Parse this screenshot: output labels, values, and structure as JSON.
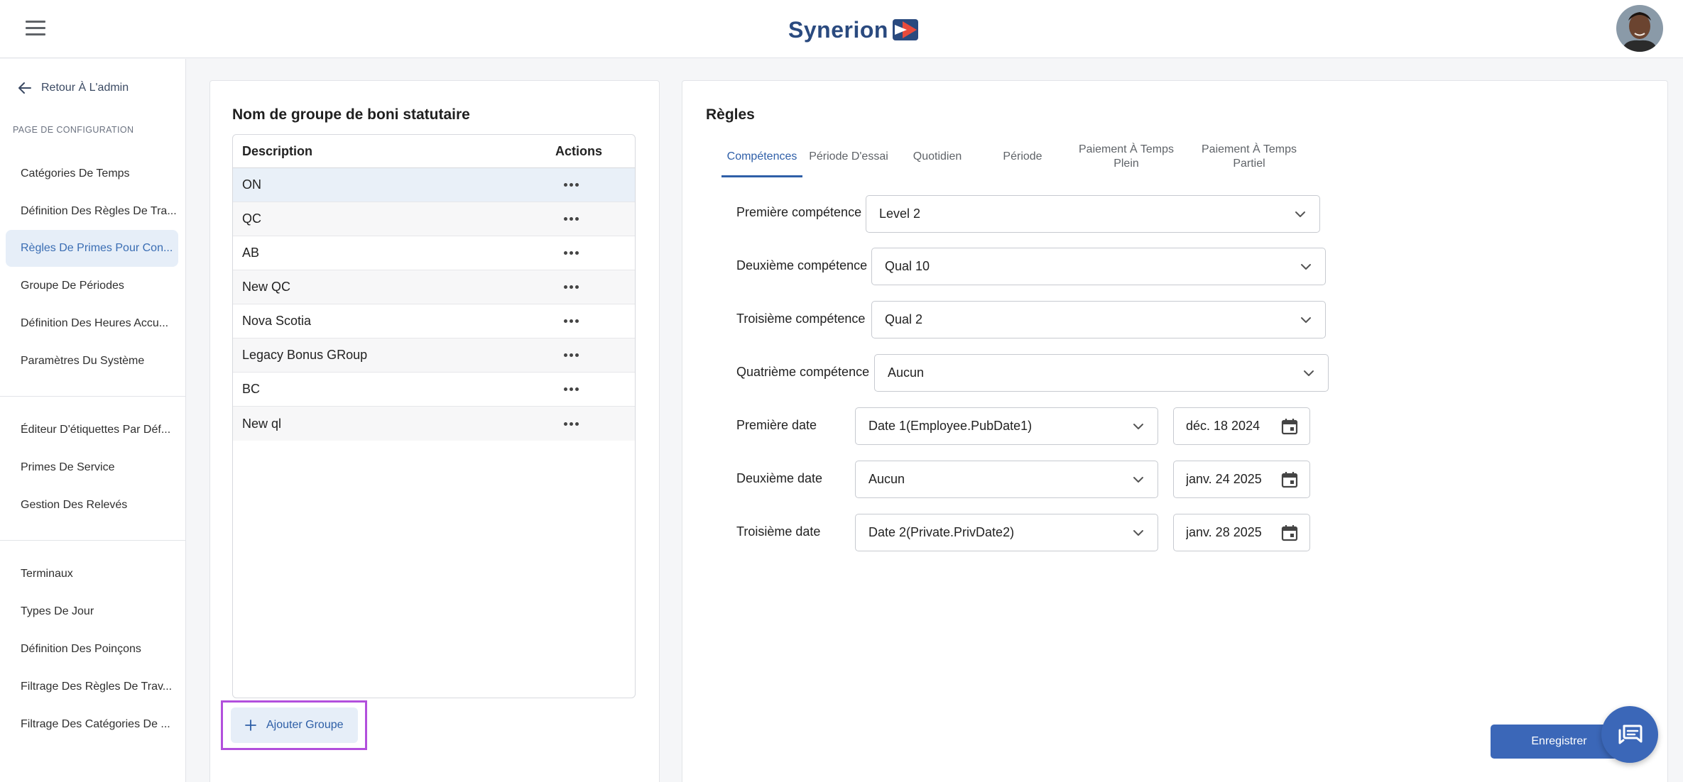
{
  "app": {
    "brand": "Synerion"
  },
  "sidebar": {
    "back_label": "Retour À L'admin",
    "section_label": "PAGE DE CONFIGURATION",
    "items": [
      {
        "label": "Catégories De Temps"
      },
      {
        "label": "Définition Des Règles De Tra..."
      },
      {
        "label": "Règles De Primes Pour Con...",
        "active": true
      },
      {
        "label": "Groupe De Périodes"
      },
      {
        "label": "Définition Des Heures Accu..."
      },
      {
        "label": "Paramètres Du Système"
      },
      {
        "label": "Éditeur D'étiquettes Par Déf..."
      },
      {
        "label": "Primes De Service"
      },
      {
        "label": "Gestion Des Relevés"
      },
      {
        "label": "Terminaux"
      },
      {
        "label": "Types De Jour"
      },
      {
        "label": "Définition Des Poinçons"
      },
      {
        "label": "Filtrage Des Règles De Trav..."
      },
      {
        "label": "Filtrage Des Catégories De ..."
      }
    ]
  },
  "groups_panel": {
    "title": "Nom de groupe de boni statutaire",
    "columns": {
      "description": "Description",
      "actions": "Actions"
    },
    "rows": [
      {
        "description": "ON",
        "selected": true
      },
      {
        "description": "QC"
      },
      {
        "description": "AB"
      },
      {
        "description": "New QC"
      },
      {
        "description": "Nova Scotia"
      },
      {
        "description": "Legacy Bonus GRoup"
      },
      {
        "description": "BC"
      },
      {
        "description": "New ql"
      }
    ],
    "add_button": "Ajouter Groupe"
  },
  "rules_panel": {
    "title": "Règles",
    "tabs": [
      {
        "label": "Compétences",
        "active": true
      },
      {
        "label": "Période D'essai"
      },
      {
        "label": "Quotidien"
      },
      {
        "label": "Période"
      },
      {
        "label": "Paiement À Temps Plein"
      },
      {
        "label": "Paiement À Temps Partiel"
      }
    ],
    "competences": [
      {
        "label": "Première compétence",
        "value": "Level 2"
      },
      {
        "label": "Deuxième compétence",
        "value": "Qual 10"
      },
      {
        "label": "Troisième compétence",
        "value": "Qual 2"
      },
      {
        "label": "Quatrième compétence",
        "value": "Aucun"
      }
    ],
    "dates": [
      {
        "label": "Première date",
        "value": "Date 1(Employee.PubDate1)",
        "date": "déc. 18 2024"
      },
      {
        "label": "Deuxième date",
        "value": "Aucun",
        "date": "janv. 24 2025"
      },
      {
        "label": "Troisième date",
        "value": "Date 2(Private.PrivDate2)",
        "date": "janv. 28 2025"
      }
    ],
    "save_button": "Enregistrer"
  },
  "colors": {
    "accent": "#3b67b8",
    "active_bg": "#e6eef8",
    "highlight": "#b24fdc"
  },
  "icons": [
    "menu-icon",
    "arrow-left-icon",
    "more-horizontal-icon",
    "plus-icon",
    "chevron-down-icon",
    "calendar-icon",
    "chat-icon"
  ]
}
